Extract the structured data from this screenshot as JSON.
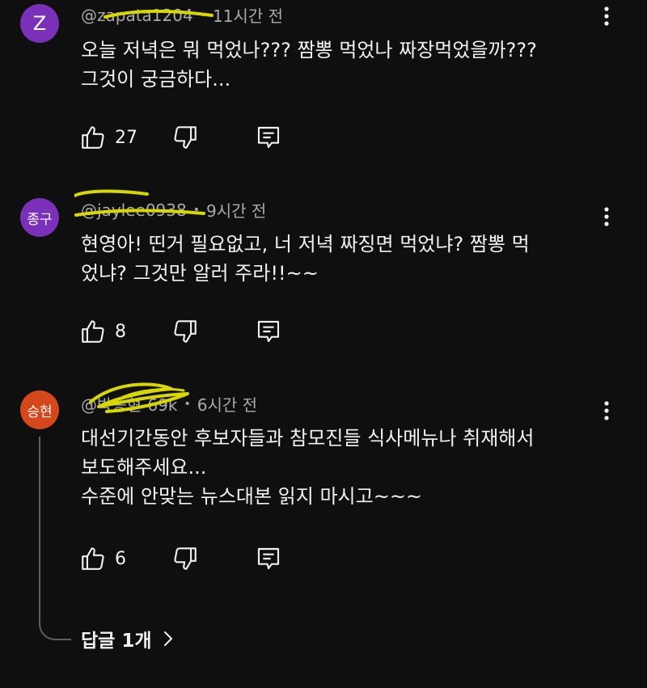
{
  "comments": [
    {
      "avatar": {
        "text": "Z",
        "color": "#7a30b8"
      },
      "handle": "@zapata1204",
      "time": "11시간 전",
      "text": "오늘 저녁은 뭐 먹었나??? 짬뽕 먹었나 짜장먹었을까???\n그것이 궁금하다...",
      "likes": "27"
    },
    {
      "avatar": {
        "text": "종구",
        "color": "#7a30b8"
      },
      "handle": "@jaylee0938",
      "time": "9시간 전",
      "text": "현영아! 띤거 필요없고,  너 저녁 짜징면 먹었냐? 짬뽕 먹\n었냐? 그것만 알러 주라!!~~",
      "likes": "8"
    },
    {
      "avatar": {
        "text": "승현",
        "color": "#d4481c"
      },
      "handle": "@박승현-69k",
      "time": "6시간 전",
      "text": "대선기간동안 후보자들과 참모진들  식사메뉴나 취재해서\n보도해주세요...\n수준에 안맞는 뉴스대본 읽지 마시고~~~",
      "likes": "6"
    }
  ],
  "replies_label": "답글 1개",
  "icons": {
    "like": "thumbs-up-icon",
    "dislike": "thumbs-down-icon",
    "reply": "reply-comment-icon",
    "more": "more-vert-icon",
    "expand": "chevron-right-icon"
  },
  "colors": {
    "background": "#0f0f0f",
    "text": "#f1f1f1",
    "muted": "#aaaaaa",
    "scribble": "#d8d800"
  }
}
